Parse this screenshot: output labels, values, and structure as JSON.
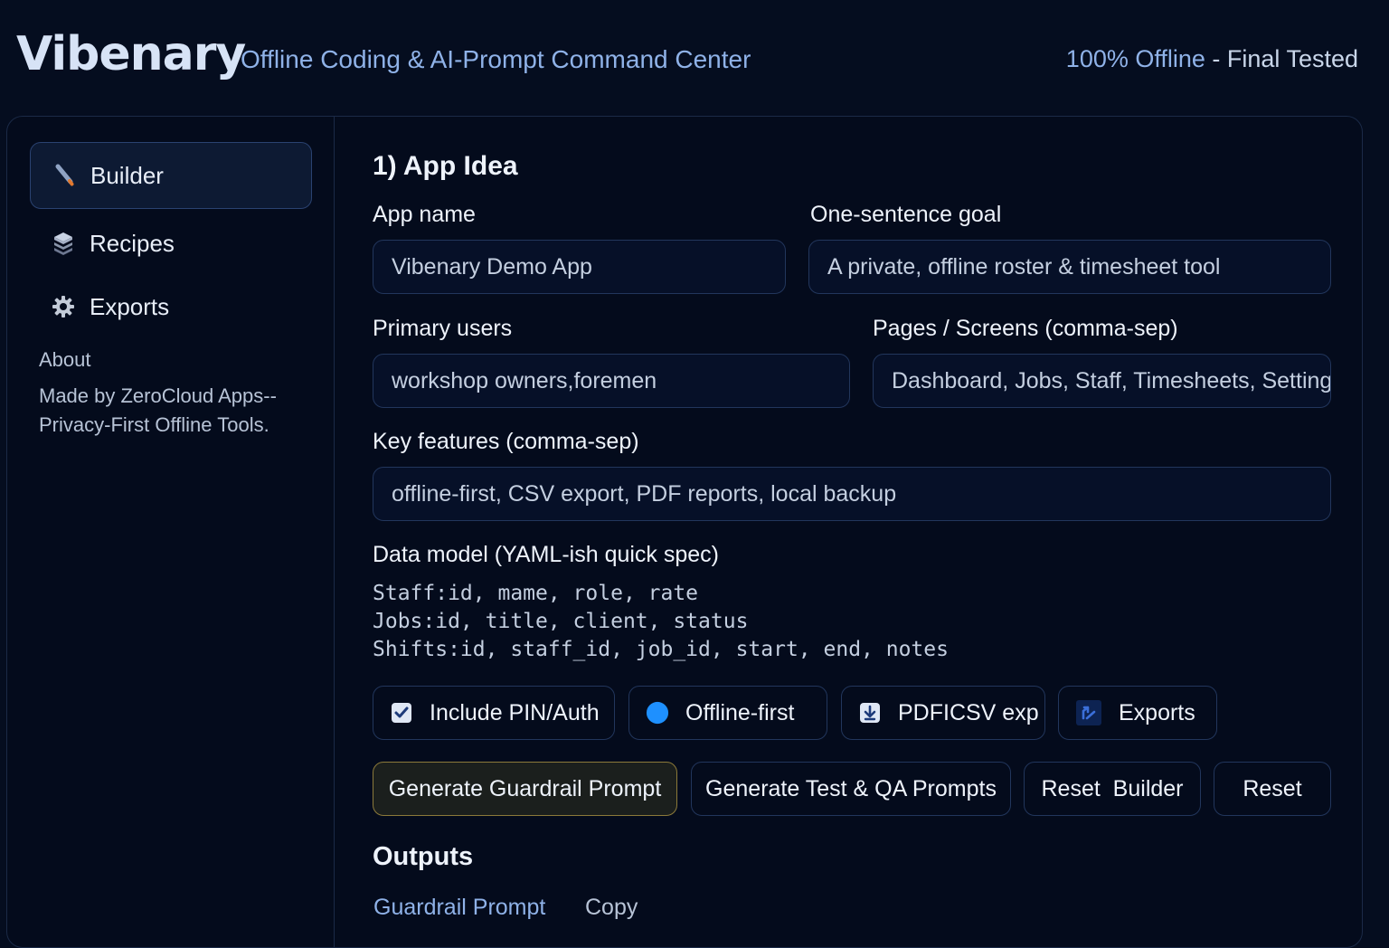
{
  "header": {
    "brand": "Vibenary",
    "tagline": "Offline Coding & AI-Prompt Command Center",
    "status_main": "100% Offline",
    "status_sep": " - ",
    "status_tested": "Final Tested"
  },
  "sidebar": {
    "items": [
      {
        "label": "Builder",
        "icon": "pencil-icon",
        "active": true
      },
      {
        "label": "Recipes",
        "icon": "layers-icon"
      },
      {
        "label": "Exports",
        "icon": "gear-icon"
      }
    ],
    "about_title": "About",
    "about_text": "Made by ZeroCloud Apps--Privacy-First Offline Tools."
  },
  "main": {
    "section_title": "1) App Idea",
    "app_name_label": "App name",
    "app_name_value": "Vibenary Demo App",
    "goal_label": "One-sentence goal",
    "goal_value": "A private, offline roster & timesheet tool",
    "users_label": "Primary users",
    "users_value": "workshop owners,foremen",
    "pages_label": "Pages / Screens (comma-sep)",
    "pages_value": "Dashboard, Jobs, Staff, Timesheets, Setting",
    "features_label": "Key features (comma-sep)",
    "features_value": "offline-first, CSV export, PDF reports, local backup",
    "data_model_label": "Data model (YAML-ish quick spec)",
    "data_model_lines": [
      "Staff:id, mame, role, rate",
      "Jobs:id, title, client, status",
      "Shifts:id, staff_id, job_id, start, end, notes"
    ],
    "options": [
      {
        "label": "Include PIN/Auth",
        "icon": "checkbox-checked-icon"
      },
      {
        "label": "Offline-first",
        "icon": "radio-dot-icon"
      },
      {
        "label": "PDFICSV exp",
        "icon": "download-icon"
      },
      {
        "label": "Exports",
        "icon": "export-icon"
      }
    ],
    "buttons": {
      "guardrail": "Generate Guardrail Prompt",
      "test_qa": "Generate Test & QA Prompts",
      "reset_builder": "Reset  Builder",
      "reset": "Reset"
    },
    "outputs_title": "Outputs",
    "output_tab": "Guardrail Prompt",
    "copy_label": "Copy"
  },
  "colors": {
    "background": "#050d1f",
    "accent_text": "#8fb2e8",
    "border": "#22365c",
    "primary_button_border": "#8c7a3a",
    "radio_blue": "#1e90ff"
  }
}
